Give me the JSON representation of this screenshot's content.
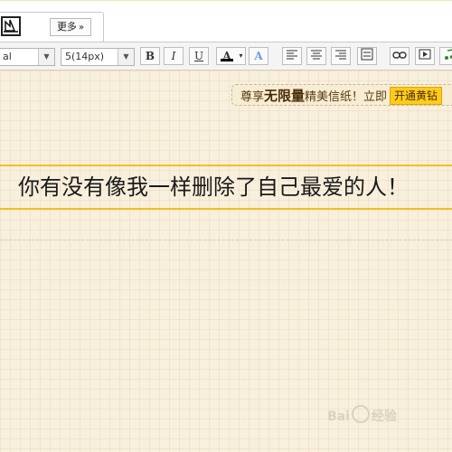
{
  "tabs": {
    "more_label": "更多",
    "more_chevron": "»"
  },
  "toolbar": {
    "font_family_value": "al",
    "font_size_value": "5(14px)",
    "bold_label": "B",
    "italic_label": "I",
    "underline_label": "U",
    "font_color_label": "A",
    "text_bg_label": "A"
  },
  "promo": {
    "prefix": "尊享",
    "highlight": "无限量",
    "suffix": "精美信纸！立即",
    "button_label": "开通黄钻"
  },
  "editor": {
    "headline": "你有没有像我一样删除了自己最爱的人！"
  },
  "watermark": {
    "text_left": "Bai",
    "text_right": "经验"
  },
  "colors": {
    "accent_bar": "#f4c020",
    "promo_button": "#ffcc1a",
    "paper_bg": "#f8efdd"
  }
}
